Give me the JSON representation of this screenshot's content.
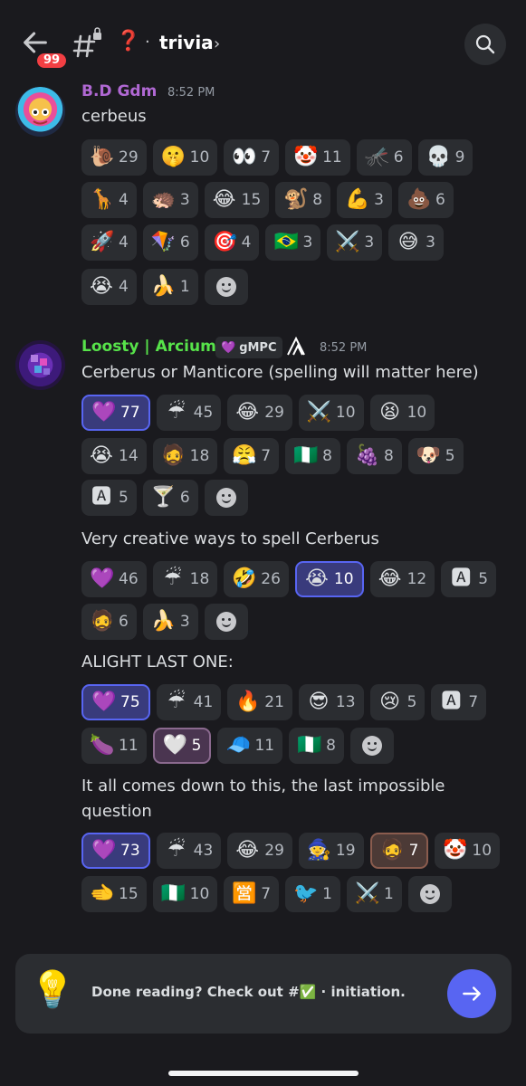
{
  "header": {
    "unread_badge": "99",
    "channel_emoji": "❓",
    "channel_name": "trivia",
    "dot": "·"
  },
  "messages": [
    {
      "author": "B.D Gdm",
      "author_color": "#b068d3",
      "time": "8:52 PM",
      "text": "cerbeus",
      "reaction_rows": [
        [
          {
            "emoji": "🐌",
            "count": "29"
          },
          {
            "emoji": "🤫",
            "count": "10"
          },
          {
            "emoji": "👀",
            "count": "7"
          },
          {
            "emoji": "🤡",
            "count": "11"
          },
          {
            "emoji": "🦟",
            "count": "6"
          },
          {
            "emoji": "💀",
            "count": "9"
          }
        ],
        [
          {
            "emoji": "🦒",
            "count": "4"
          },
          {
            "emoji": "🦔",
            "count": "3"
          },
          {
            "emoji": "😂",
            "count": "15"
          },
          {
            "emoji": "🐒",
            "count": "8"
          },
          {
            "emoji": "💪",
            "count": "3"
          },
          {
            "emoji": "💩",
            "count": "6"
          }
        ],
        [
          {
            "emoji": "🚀",
            "count": "4"
          },
          {
            "emoji": "🪁",
            "count": "6"
          },
          {
            "emoji": "🎯",
            "count": "4"
          },
          {
            "emoji": "🇧🇷",
            "count": "3"
          },
          {
            "emoji": "⚔️",
            "count": "3"
          },
          {
            "emoji": "😅",
            "count": "3"
          }
        ],
        [
          {
            "emoji": "😭",
            "count": "4"
          },
          {
            "emoji": "🍌",
            "count": "1"
          }
        ]
      ]
    },
    {
      "author": "Loosty | Arcium",
      "author_color": "#57e34a",
      "tag": "gMPC",
      "time": "8:52 PM",
      "text": "Cerberus or Manticore (spelling will matter here)",
      "reaction_rows": [
        [
          {
            "emoji": "💜",
            "count": "77",
            "state": "sel"
          },
          {
            "emoji": "☔",
            "count": "45"
          },
          {
            "emoji": "😂",
            "count": "29"
          },
          {
            "emoji": "⚔️",
            "count": "10"
          },
          {
            "emoji": "😫",
            "count": "10"
          }
        ],
        [
          {
            "emoji": "😭",
            "count": "14"
          },
          {
            "emoji": "🧔",
            "count": "18"
          },
          {
            "emoji": "😤",
            "count": "7"
          },
          {
            "emoji": "🇳🇬",
            "count": "8"
          },
          {
            "emoji": "🍇",
            "count": "8"
          },
          {
            "emoji": "🐶",
            "count": "5"
          }
        ],
        [
          {
            "emoji": "🅰",
            "count": "5"
          },
          {
            "emoji": "🍸",
            "count": "6"
          }
        ]
      ]
    },
    {
      "text": "Very creative ways to spell Cerberus",
      "reaction_rows": [
        [
          {
            "emoji": "💜",
            "count": "46"
          },
          {
            "emoji": "☔",
            "count": "18"
          },
          {
            "emoji": "🤣",
            "count": "26"
          },
          {
            "emoji": "😭",
            "count": "10",
            "state": "sel"
          },
          {
            "emoji": "😂",
            "count": "12"
          },
          {
            "emoji": "🅰",
            "count": "5"
          }
        ],
        [
          {
            "emoji": "🧔",
            "count": "6"
          },
          {
            "emoji": "🍌",
            "count": "3"
          }
        ]
      ]
    },
    {
      "text": "ALIGHT LAST ONE:",
      "reaction_rows": [
        [
          {
            "emoji": "💜",
            "count": "75",
            "state": "sel"
          },
          {
            "emoji": "☔",
            "count": "41"
          },
          {
            "emoji": "🔥",
            "count": "21"
          },
          {
            "emoji": "😎",
            "count": "13"
          },
          {
            "emoji": "😢",
            "count": "5"
          },
          {
            "emoji": "🅰",
            "count": "7"
          }
        ],
        [
          {
            "emoji": "🍆",
            "count": "11"
          },
          {
            "emoji": "🤍",
            "count": "5",
            "state": "selp"
          },
          {
            "emoji": "🧢",
            "count": "11"
          },
          {
            "emoji": "🇳🇬",
            "count": "8"
          }
        ]
      ]
    },
    {
      "text": "It all comes down to this, the last impossible question",
      "reaction_rows": [
        [
          {
            "emoji": "💜",
            "count": "73",
            "state": "sel"
          },
          {
            "emoji": "☔",
            "count": "43"
          },
          {
            "emoji": "😂",
            "count": "29"
          },
          {
            "emoji": "🧙",
            "count": "19"
          },
          {
            "emoji": "🧔",
            "count": "7",
            "state": "selr"
          },
          {
            "emoji": "🤡",
            "count": "10"
          }
        ],
        [
          {
            "emoji": "🫲",
            "count": "15"
          },
          {
            "emoji": "🇳🇬",
            "count": "10"
          },
          {
            "emoji": "🈺",
            "count": "7"
          },
          {
            "emoji": "🐦",
            "count": "1"
          },
          {
            "emoji": "⚔️",
            "count": "1"
          }
        ]
      ]
    }
  ],
  "footer": {
    "mascot": "💡",
    "prompt": "Done reading? Check out #✅ · initiation."
  },
  "colors": {
    "background": "#1a1a1e",
    "chip": "#2b2d31",
    "accent": "#5865f2",
    "badge": "#f23f43"
  }
}
